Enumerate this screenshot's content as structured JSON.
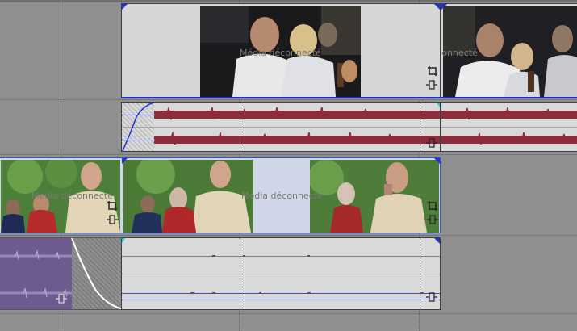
{
  "timeline": {
    "offline_label": "Média déconnecté",
    "colors": {
      "background": "#8f8f8f",
      "clip_bg": "#d6d6d6",
      "waveform": "#8e2b3c",
      "selection_blue": "#2f52c8",
      "fade_purple": "#6d5a8f"
    },
    "tracks": [
      {
        "name": "video-track-1",
        "type": "video",
        "clips": 2
      },
      {
        "name": "audio-track-1",
        "type": "audio",
        "clips": 2
      },
      {
        "name": "video-track-2",
        "type": "video",
        "clips": 1,
        "selected": true
      },
      {
        "name": "audio-track-2",
        "type": "audio",
        "clips": 2
      }
    ],
    "icons": [
      "crop-icon",
      "event-fx-icon"
    ]
  }
}
